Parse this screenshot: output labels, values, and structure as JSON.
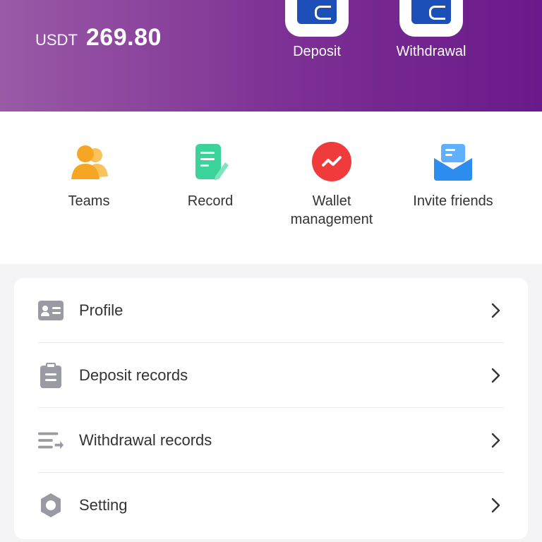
{
  "header": {
    "title_fragment": "",
    "currency": "USDT",
    "balance": "269.80",
    "actions": [
      {
        "label": "Deposit",
        "icon": "wallet-icon"
      },
      {
        "label": "Withdrawal",
        "icon": "wallet-icon"
      }
    ],
    "colors": {
      "gradient_start": "#9a5aa6",
      "gradient_end": "#6a1a8a",
      "wallet_blue": "#1d4fb8"
    }
  },
  "quick_actions": [
    {
      "label": "Teams",
      "icon": "users-icon",
      "color": "#f6a623"
    },
    {
      "label": "Record",
      "icon": "document-edit-icon",
      "color": "#3ad39a"
    },
    {
      "label": "Wallet management",
      "icon": "trend-chart-icon",
      "color": "#ef3b3b"
    },
    {
      "label": "Invite friends",
      "icon": "mail-icon",
      "color": "#2d8cf0"
    }
  ],
  "menu": [
    {
      "label": "Profile",
      "icon": "id-card-icon"
    },
    {
      "label": "Deposit records",
      "icon": "clipboard-icon"
    },
    {
      "label": "Withdrawal records",
      "icon": "transfer-list-icon"
    },
    {
      "label": "Setting",
      "icon": "gear-icon"
    }
  ]
}
